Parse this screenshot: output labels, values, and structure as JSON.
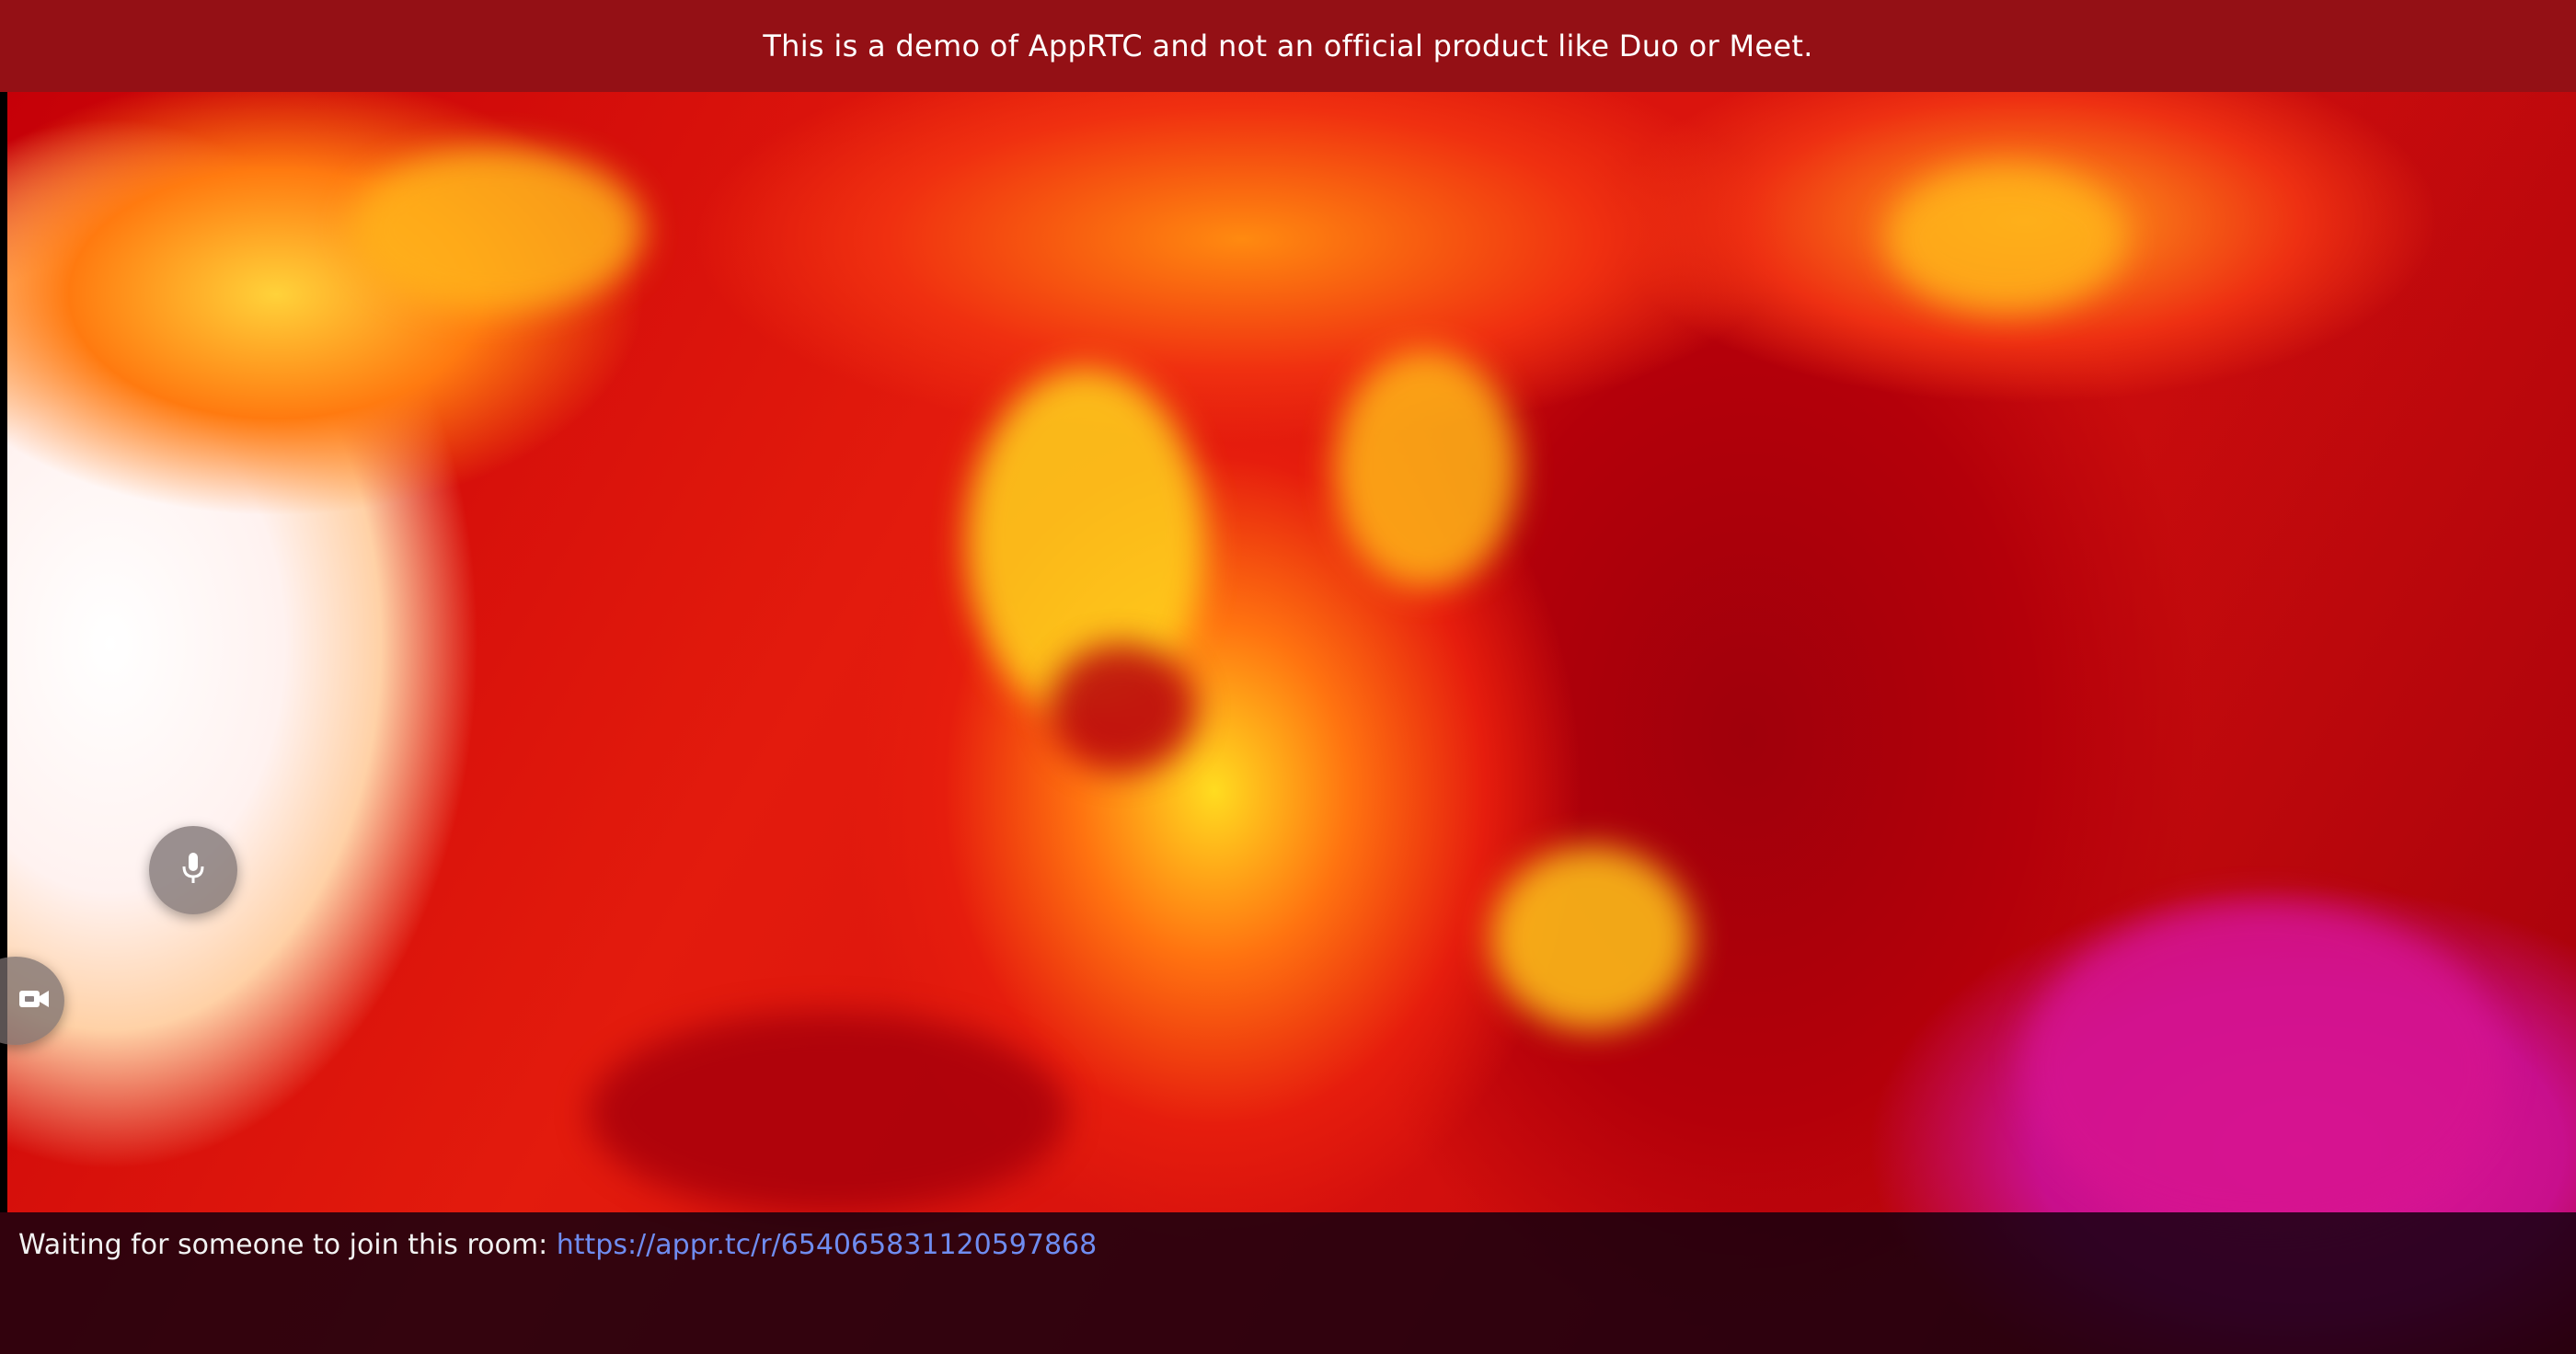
{
  "banner": {
    "text": "This is a demo of AppRTC and not an official product like Duo or Meet."
  },
  "controls": {
    "mic_icon": "microphone-icon",
    "camera_icon": "video-camera-icon"
  },
  "status": {
    "waiting_text": "Waiting for someone to join this room: ",
    "room_url": "https://appr.tc/r/654065831120597868"
  },
  "colors": {
    "banner_bg": "#941015",
    "link": "#6f8cf0",
    "status_bg": "#12000e"
  }
}
